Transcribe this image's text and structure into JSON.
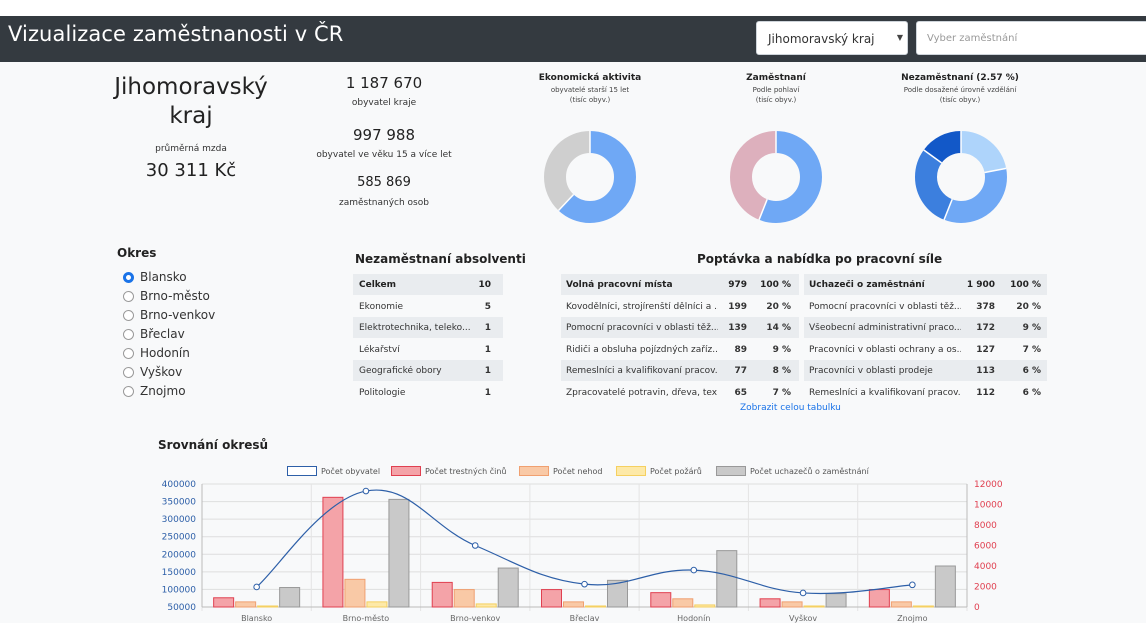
{
  "header": {
    "title": "Vizualizace zaměstnanosti v ČR",
    "region_select": "Jihomoravský kraj",
    "job_search_placeholder": "Vyber zaměstnání"
  },
  "summary": {
    "region_line1": "Jihomoravský",
    "region_line2": "kraj",
    "salary_label": "průměrná mzda",
    "salary_value": "30 311 Kč",
    "population_value": "1 187 670",
    "population_label": "obyvatel kraje",
    "adult_value": "997 988",
    "adult_label": "obyvatel ve věku 15 a více let",
    "employed_value": "585 869",
    "employed_label": "zaměstnaných osob"
  },
  "donuts": [
    {
      "title": "Ekonomická aktivita",
      "sub1": "obyvatelé starší 15 let",
      "sub2": "(tisíc obyv.)",
      "values": [
        0.62,
        0.38
      ],
      "colors": [
        "#6fa8f5",
        "#cfcfcf"
      ]
    },
    {
      "title": "Zaměstnaní",
      "sub1": "Podle pohlaví",
      "sub2": "(tisíc obyv.)",
      "values": [
        0.56,
        0.44
      ],
      "colors": [
        "#6fa8f5",
        "#ddb0bd"
      ]
    },
    {
      "title": "Nezaměstnaní (2.57 %)",
      "sub1": "Podle dosažené úrovně vzdělání",
      "sub2": "(tisíc obyv.)",
      "values": [
        0.22,
        0.34,
        0.29,
        0.15
      ],
      "colors": [
        "#aed4fb",
        "#6fa8f5",
        "#3c7fde",
        "#1258c8"
      ]
    }
  ],
  "okres": {
    "title": "Okres",
    "options": [
      "Blansko",
      "Brno-město",
      "Brno-venkov",
      "Břeclav",
      "Hodonín",
      "Vyškov",
      "Znojmo"
    ],
    "selected": "Blansko"
  },
  "graduates": {
    "title": "Nezaměstnaní absolventi",
    "rows": [
      {
        "name": "Celkem",
        "value": "10"
      },
      {
        "name": "Ekonomie",
        "value": "5"
      },
      {
        "name": "Elektrotechnika, teleko...",
        "value": "1"
      },
      {
        "name": "Lékařství",
        "value": "1"
      },
      {
        "name": "Geografické obory",
        "value": "1"
      },
      {
        "name": "Politologie",
        "value": "1"
      }
    ]
  },
  "labor": {
    "title": "Poptávka a nabídka po pracovní síle",
    "vacancies": [
      {
        "name": "Volná pracovní místa",
        "count": "979",
        "pct": "100 %"
      },
      {
        "name": "Kovodělníci, strojírenští dělníci a ...",
        "count": "199",
        "pct": "20 %"
      },
      {
        "name": "Pomocní pracovníci v oblasti těž...",
        "count": "139",
        "pct": "14 %"
      },
      {
        "name": "Řidiči a obsluha pojízdných zaříz...",
        "count": "89",
        "pct": "9 %"
      },
      {
        "name": "Řemeslníci a kvalifikovaní pracov...",
        "count": "77",
        "pct": "8 %"
      },
      {
        "name": "Zpracovatelé potravin, dřeva, tex...",
        "count": "65",
        "pct": "7 %"
      }
    ],
    "applicants": [
      {
        "name": "Uchazeči o zaměstnání",
        "count": "1 900",
        "pct": "100 %"
      },
      {
        "name": "Pomocní pracovníci v oblasti těž...",
        "count": "378",
        "pct": "20 %"
      },
      {
        "name": "Všeobecní administrativní praco...",
        "count": "172",
        "pct": "9 %"
      },
      {
        "name": "Pracovníci v oblasti ochrany a os...",
        "count": "127",
        "pct": "7 %"
      },
      {
        "name": "Pracovníci v oblasti prodeje",
        "count": "113",
        "pct": "6 %"
      },
      {
        "name": "Řemeslníci a kvalifikovaní pracov...",
        "count": "112",
        "pct": "6 %"
      }
    ],
    "link": "Zobrazit celou tabulku"
  },
  "compare_title": "Srovnání okresů",
  "chart_data": {
    "type": "bar",
    "categories": [
      "Blansko",
      "Brno-město",
      "Brno-venkov",
      "Břeclav",
      "Hodonín",
      "Vyškov",
      "Znojmo"
    ],
    "series": [
      {
        "name": "Počet obyvatel",
        "type": "line",
        "axis": "left",
        "color": "#2d5fa8",
        "values": [
          107000,
          380000,
          225000,
          115000,
          155000,
          90000,
          113000
        ]
      },
      {
        "name": "Počet trestných činů",
        "type": "bar",
        "axis": "right",
        "color": "#f4a3a8",
        "border": "#e04050",
        "values": [
          900,
          10700,
          2400,
          1700,
          1400,
          800,
          1700
        ]
      },
      {
        "name": "Počet nehod",
        "type": "bar",
        "axis": "right",
        "color": "#f9c9a6",
        "border": "#f0a070",
        "values": [
          500,
          2700,
          1700,
          500,
          800,
          500,
          500
        ]
      },
      {
        "name": "Počet požárů",
        "type": "bar",
        "axis": "right",
        "color": "#fde9a8",
        "border": "#f5d060",
        "values": [
          100,
          500,
          300,
          100,
          200,
          100,
          100
        ]
      },
      {
        "name": "Počet uchazečů o zaměstnání",
        "type": "bar",
        "axis": "right",
        "color": "#c9c9c9",
        "border": "#999999",
        "values": [
          1900,
          10500,
          3800,
          2600,
          5500,
          1300,
          4000
        ]
      }
    ],
    "y_left": {
      "ticks": [
        "400000",
        "350000",
        "300000",
        "250000",
        "200000",
        "150000",
        "100000",
        "50000"
      ],
      "min": 50000,
      "max": 400000,
      "color": "#2d5fa8"
    },
    "y_right": {
      "ticks": [
        "12000",
        "10000",
        "8000",
        "6000",
        "4000",
        "2000",
        "0"
      ],
      "min": 0,
      "max": 12000,
      "color": "#e04050"
    },
    "grid": true,
    "legend_position": "top"
  }
}
